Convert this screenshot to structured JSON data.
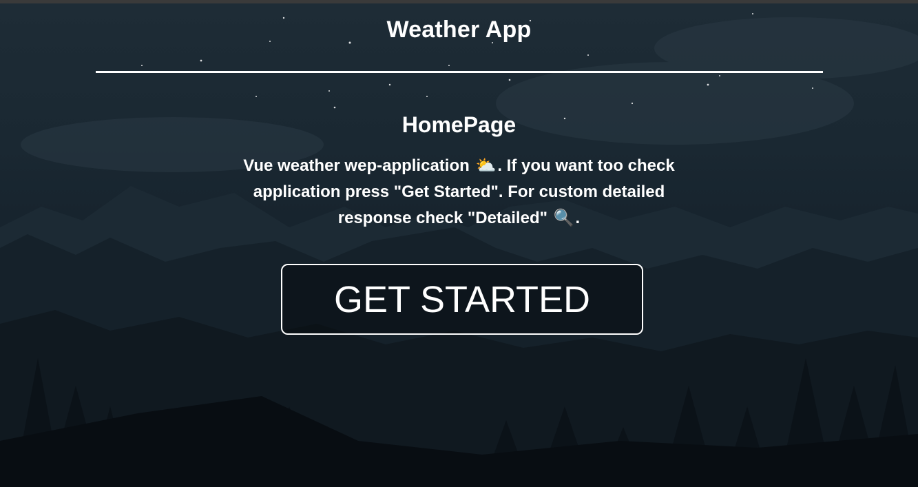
{
  "header": {
    "title": "Weather App"
  },
  "main": {
    "heading": "HomePage",
    "description": {
      "part1": "Vue weather wep-application",
      "emoji_weather": "⛅",
      "part2": ". If you want too check application press \"Get Started\". For custom detailed response check \"Detailed\"",
      "emoji_search": "🔍",
      "part3": "."
    },
    "cta_label": "GET STARTED"
  },
  "icons": {
    "weather": "sun-behind-cloud-icon",
    "search": "magnifying-glass-icon"
  },
  "colors": {
    "text": "#ffffff",
    "sky": "#1e2c36",
    "forest": "#0a1016"
  }
}
